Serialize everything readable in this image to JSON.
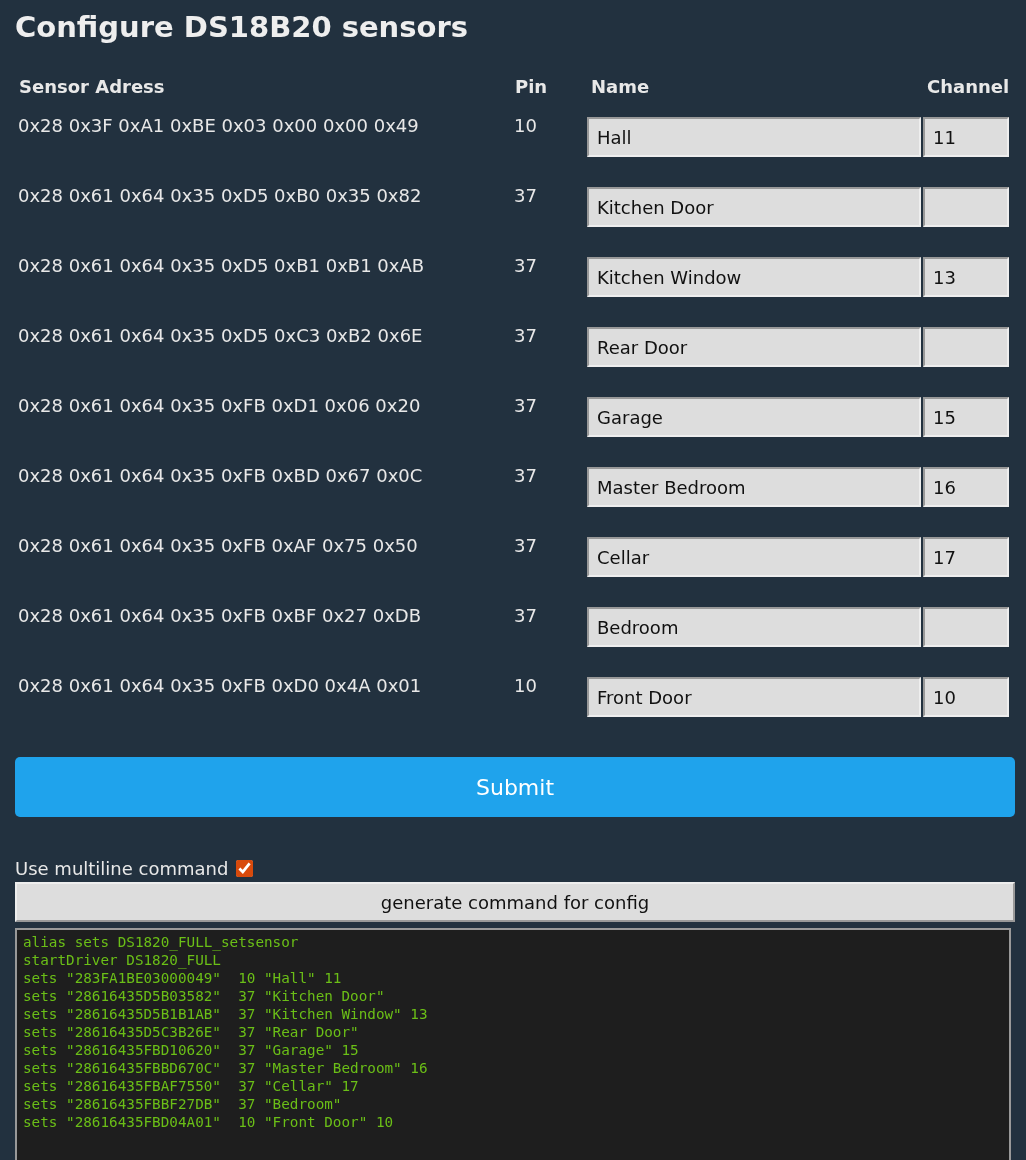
{
  "title": "Configure DS18B20 sensors",
  "columns": [
    "Sensor Adress",
    "Pin",
    "Name",
    "Channel"
  ],
  "sensors": [
    {
      "address": "0x28 0x3F 0xA1 0xBE 0x03 0x00 0x00 0x49",
      "pin": "10",
      "name": "Hall",
      "channel": "11"
    },
    {
      "address": "0x28 0x61 0x64 0x35 0xD5 0xB0 0x35 0x82",
      "pin": "37",
      "name": "Kitchen Door"
    },
    {
      "address": "0x28 0x61 0x64 0x35 0xD5 0xB1 0xB1 0xAB",
      "pin": "37",
      "name": "Kitchen Window",
      "channel": "13"
    },
    {
      "address": "0x28 0x61 0x64 0x35 0xD5 0xC3 0xB2 0x6E",
      "pin": "37",
      "name": "Rear Door"
    },
    {
      "address": "0x28 0x61 0x64 0x35 0xFB 0xD1 0x06 0x20",
      "pin": "37",
      "name": "Garage",
      "channel": "15"
    },
    {
      "address": "0x28 0x61 0x64 0x35 0xFB 0xBD 0x67 0x0C",
      "pin": "37",
      "name": "Master Bedroom",
      "channel": "16"
    },
    {
      "address": "0x28 0x61 0x64 0x35 0xFB 0xAF 0x75 0x50",
      "pin": "37",
      "name": "Cellar",
      "channel": "17"
    },
    {
      "address": "0x28 0x61 0x64 0x35 0xFB 0xBF 0x27 0xDB",
      "pin": "37",
      "name": "Bedroom"
    },
    {
      "address": "0x28 0x61 0x64 0x35 0xFB 0xD0 0x4A 0x01",
      "pin": "10",
      "name": "Front Door",
      "channel": "10"
    }
  ],
  "submit_button": "Submit",
  "multiline": {
    "label": "Use multiline command",
    "checked": true
  },
  "generate_button": "generate command for config",
  "command_output": [
    "alias sets DS1820_FULL_setsensor",
    "startDriver DS1820_FULL",
    "sets \"283FA1BE03000049\"  10 \"Hall\" 11",
    "sets \"28616435D5B03582\"  37 \"Kitchen Door\"",
    "sets \"28616435D5B1B1AB\"  37 \"Kitchen Window\" 13",
    "sets \"28616435D5C3B26E\"  37 \"Rear Door\"",
    "sets \"28616435FBD10620\"  37 \"Garage\" 15",
    "sets \"28616435FBBD670C\"  37 \"Master Bedroom\" 16",
    "sets \"28616435FBAF7550\"  37 \"Cellar\" 17",
    "sets \"28616435FBBF27DB\"  37 \"Bedroom\"",
    "sets \"28616435FBD04A01\"  10 \"Front Door\" 10"
  ]
}
